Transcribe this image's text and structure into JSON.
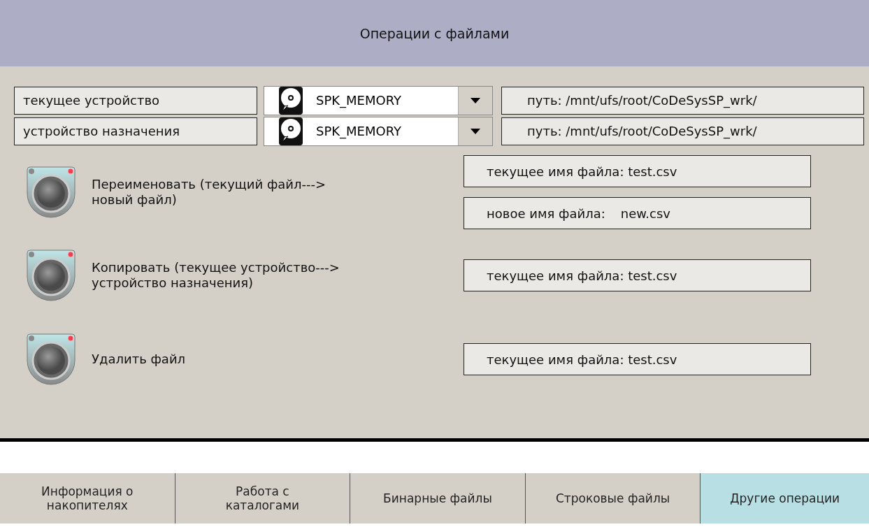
{
  "header": {
    "title": "Операции с файлами"
  },
  "devices": [
    {
      "label": "текущее устройство",
      "value": "SPK_MEMORY",
      "path": "путь: /mnt/ufs/root/CoDeSysSP_wrk/"
    },
    {
      "label": "устройство назначения",
      "value": "SPK_MEMORY",
      "path": "путь: /mnt/ufs/root/CoDeSysSP_wrk/"
    }
  ],
  "operations": [
    {
      "label": "Переименовать (текущий файл--->\nновый файл)",
      "fields": [
        {
          "label": "текущее имя файла: test.csv"
        },
        {
          "label": "новое имя файла:",
          "value": "new.csv"
        }
      ]
    },
    {
      "label": "Копировать (текущее устройство--->\nустройство назначения)",
      "fields": [
        {
          "label": "текущее имя файла: test.csv"
        }
      ]
    },
    {
      "label": "Удалить файл",
      "fields": [
        {
          "label": "текущее имя файла: test.csv"
        }
      ]
    }
  ],
  "tabs": [
    {
      "label": "Информация о\nнакопителях",
      "selected": false
    },
    {
      "label": "Работа с\nкаталогами",
      "selected": false
    },
    {
      "label": "Бинарные файлы",
      "selected": false
    },
    {
      "label": "Строковые файлы",
      "selected": false
    },
    {
      "label": "Другие операции",
      "selected": true
    }
  ]
}
